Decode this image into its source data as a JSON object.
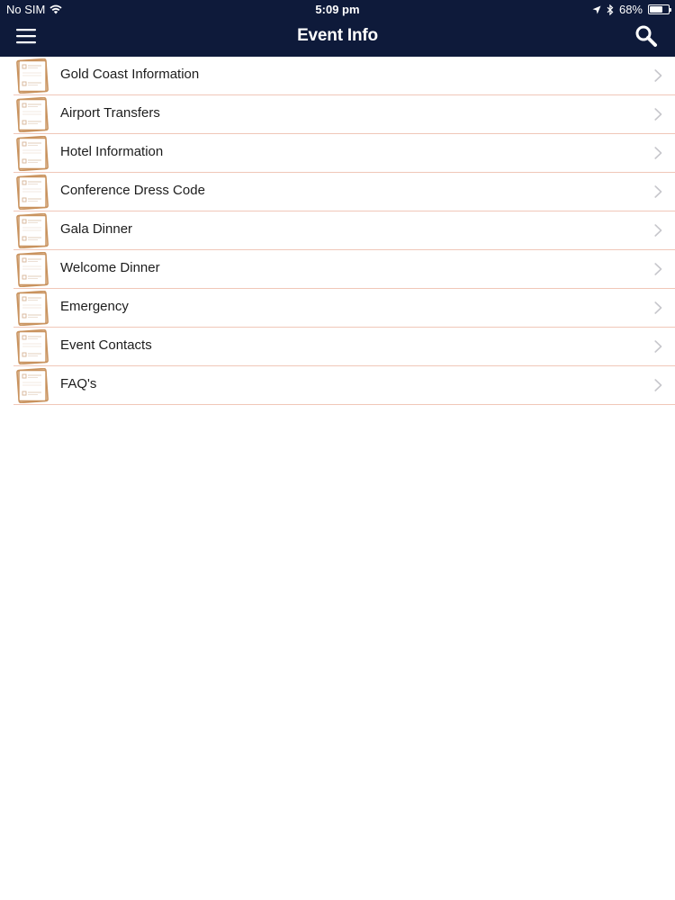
{
  "status_bar": {
    "carrier": "No SIM",
    "time": "5:09 pm",
    "battery": "68%",
    "battery_level": 0.68
  },
  "nav": {
    "title": "Event Info",
    "menu_icon": "hamburger-menu-icon",
    "search_icon": "search-icon"
  },
  "items": [
    {
      "label": "Gold Coast Information"
    },
    {
      "label": "Airport Transfers"
    },
    {
      "label": "Hotel Information"
    },
    {
      "label": "Conference Dress Code"
    },
    {
      "label": "Gala Dinner"
    },
    {
      "label": "Welcome Dinner"
    },
    {
      "label": "Emergency"
    },
    {
      "label": "Event Contacts"
    },
    {
      "label": "FAQ's"
    }
  ],
  "colors": {
    "nav_background": "#0e1a3a",
    "divider": "#f0c7b8",
    "icon_accent": "#c9935f",
    "chevron": "#c7c7cc"
  }
}
